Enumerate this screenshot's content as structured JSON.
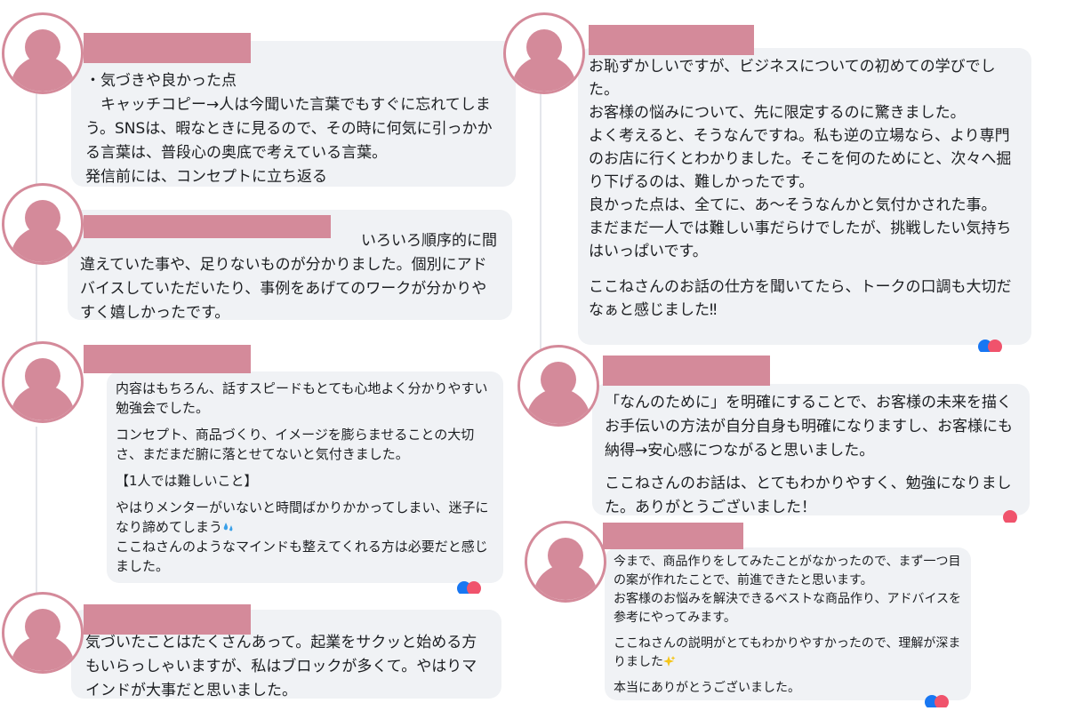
{
  "comments": [
    {
      "paragraphs": [
        "・気づきや良かった点\n　キャッチコピー→人は今聞いた言葉でもすぐに忘れてしまう。SNSは、暇なときに見るので、その時に何気に引っかかる言葉は、普段心の奥底で考えている言葉。\n発信前には、コンセプトに立ち返る"
      ]
    },
    {
      "paragraphs": [
        "いろいろ順序的に間違えていた事や、足りないものが分かりました。個別にアドバイスしていただいたり、事例をあげてのワークが分かりやすく嬉しかったです。"
      ]
    },
    {
      "paragraphs": [
        "内容はもちろん、話すスピードもとても心地よく分かりやすい勉強会でした。",
        "コンセプト、商品づくり、イメージを膨らませることの大切さ、まだまだ腑に落とせてないと気付きました。",
        "【1人では難しいこと】",
        "やはりメンターがいないと時間ばかりかかってしまい、迷子になり諦めてしまう",
        "ここねさんのようなマインドも整えてくれる方は必要だと感じました。"
      ]
    },
    {
      "paragraphs": [
        "気づいたことはたくさんあって。起業をサクッと始める方もいらっしゃいますが、私はブロックが多くて。やはりマインドが大事だと思いました。"
      ]
    },
    {
      "paragraphs": [
        "お恥ずかしいですが、ビジネスについての初めての学びでした。\nお客様の悩みについて、先に限定するのに驚きました。\nよく考えると、そうなんですね。私も逆の立場なら、より専門のお店に行くとわかりました。そこを何のためにと、次々へ掘り下げるのは、難しかったです。\n良かった点は、全てに、あ～そうなんかと気付かされた事。\nまだまだ一人では難しい事だらけでしたが、挑戦したい気持ちはいっぱいです。",
        "ここねさんのお話の仕方を聞いてたら、トークの口調も大切だなぁと感じました‼"
      ]
    },
    {
      "paragraphs": [
        "「なんのために」を明確にすることで、お客様の未来を描くお手伝いの方法が自分自身も明確になりますし、お客様にも納得→安心感につながると思いました。",
        "ここねさんのお話は、とてもわかりやすく、勉強になりました。ありがとうございました！"
      ]
    },
    {
      "paragraphs": [
        "今まで、商品作りをしてみたことがなかったので、まず一つ目の案が作れたことで、前進できたと思います。\nお客様のお悩みを解決できるベストな商品作り、アドバイスを参考にやってみます。",
        "ここねさんの説明がとてもわかりやすかったので、理解が深まりました",
        "本当にありがとうございました。"
      ]
    }
  ],
  "colors": {
    "bubble_bg": "#f0f2f5",
    "avatar_pink": "#d48a9a",
    "text": "#1c1e21"
  }
}
